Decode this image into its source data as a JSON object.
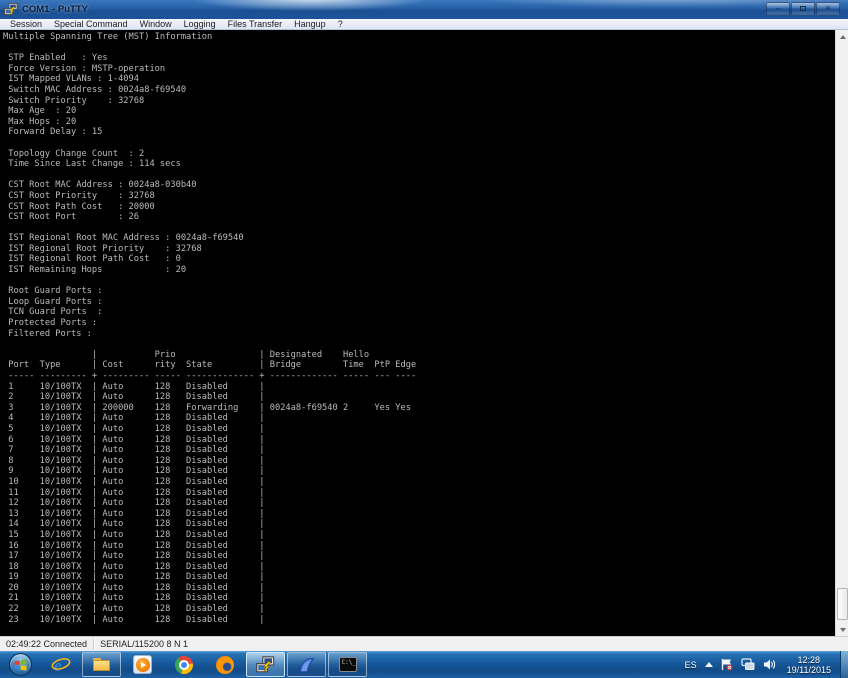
{
  "window": {
    "title": "COM1 - PuTTY",
    "controls": {
      "minimize_glyph": "–",
      "close_glyph": "×"
    }
  },
  "menu": {
    "items": [
      "Session",
      "Special Command",
      "Window",
      "Logging",
      "Files Transfer",
      "Hangup",
      "?"
    ]
  },
  "terminal": {
    "background": "#000000",
    "text_color": "#bbbbbb",
    "lines": [
      "Multiple Spanning Tree (MST) Information",
      "",
      " STP Enabled   : Yes",
      " Force Version : MSTP-operation",
      " IST Mapped VLANs : 1-4094",
      " Switch MAC Address : 0024a8-f69540",
      " Switch Priority    : 32768",
      " Max Age  : 20",
      " Max Hops : 20",
      " Forward Delay : 15",
      "",
      " Topology Change Count  : 2",
      " Time Since Last Change : 114 secs",
      "",
      " CST Root MAC Address : 0024a8-030b40",
      " CST Root Priority    : 32768",
      " CST Root Path Cost   : 20000",
      " CST Root Port        : 26",
      "",
      " IST Regional Root MAC Address : 0024a8-f69540",
      " IST Regional Root Priority    : 32768",
      " IST Regional Root Path Cost   : 0",
      " IST Remaining Hops            : 20",
      "",
      " Root Guard Ports :",
      " Loop Guard Ports :",
      " TCN Guard Ports  :",
      " Protected Ports :",
      " Filtered Ports :",
      "",
      "                 |           Prio                | Designated    Hello",
      " Port  Type      | Cost      rity  State         | Bridge        Time  PtP Edge",
      " ----- --------- + --------- ----- ------------- + ------------- ----- --- ----",
      " 1     10/100TX  | Auto      128   Disabled      |",
      " 2     10/100TX  | Auto      128   Disabled      |",
      " 3     10/100TX  | 200000    128   Forwarding    | 0024a8-f69540 2     Yes Yes",
      " 4     10/100TX  | Auto      128   Disabled      |",
      " 5     10/100TX  | Auto      128   Disabled      |",
      " 6     10/100TX  | Auto      128   Disabled      |",
      " 7     10/100TX  | Auto      128   Disabled      |",
      " 8     10/100TX  | Auto      128   Disabled      |",
      " 9     10/100TX  | Auto      128   Disabled      |",
      " 10    10/100TX  | Auto      128   Disabled      |",
      " 11    10/100TX  | Auto      128   Disabled      |",
      " 12    10/100TX  | Auto      128   Disabled      |",
      " 13    10/100TX  | Auto      128   Disabled      |",
      " 14    10/100TX  | Auto      128   Disabled      |",
      " 15    10/100TX  | Auto      128   Disabled      |",
      " 16    10/100TX  | Auto      128   Disabled      |",
      " 17    10/100TX  | Auto      128   Disabled      |",
      " 18    10/100TX  | Auto      128   Disabled      |",
      " 19    10/100TX  | Auto      128   Disabled      |",
      " 20    10/100TX  | Auto      128   Disabled      |",
      " 21    10/100TX  | Auto      128   Disabled      |",
      " 22    10/100TX  | Auto      128   Disabled      |",
      " 23    10/100TX  | Auto      128   Disabled      |"
    ]
  },
  "statusbar": {
    "connected": "02:49:22 Connected",
    "serial": "SERIAL/115200 8 N 1"
  },
  "taskbar": {
    "items": [
      "start",
      "internet-explorer",
      "windows-explorer",
      "media-player",
      "chrome",
      "firefox",
      "putty",
      "wireshark",
      "command-prompt"
    ],
    "tray": {
      "language": "ES",
      "time": "12:28",
      "date": "19/11/2015"
    }
  },
  "colors": {
    "titlebar_blue": "#255fa6",
    "taskbar_blue": "#17599c",
    "menu_bg": "#e7ecf7",
    "terminal_fg": "#bbbbbb",
    "status_bg": "#f0f0f0"
  }
}
